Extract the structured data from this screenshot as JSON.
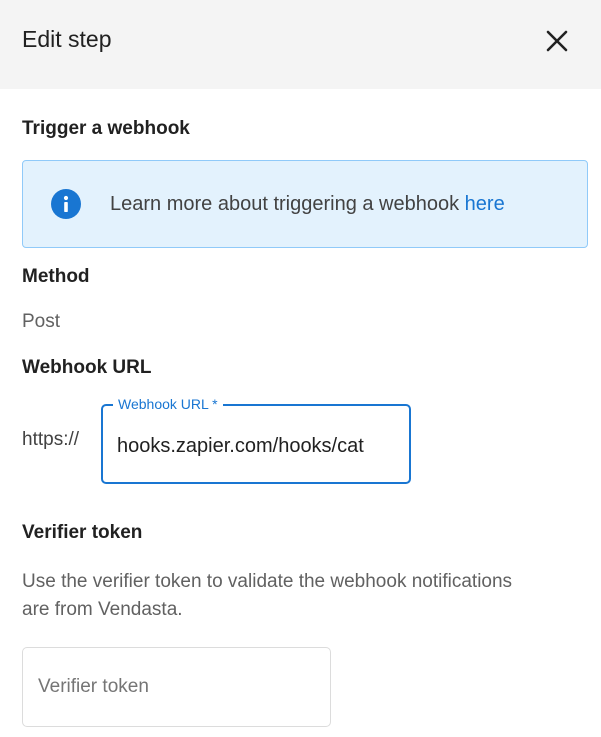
{
  "header": {
    "title": "Edit step",
    "close_icon": "close-icon"
  },
  "trigger_section": {
    "title": "Trigger a webhook",
    "info": {
      "icon": "info-icon",
      "text": "Learn more about triggering a webhook ",
      "link_label": "here"
    }
  },
  "method_section": {
    "title": "Method",
    "value": "Post"
  },
  "url_section": {
    "title": "Webhook URL",
    "prefix": "https://",
    "field_label": "Webhook URL *",
    "field_value": "hooks.zapier.com/hooks/cat"
  },
  "verifier_section": {
    "title": "Verifier token",
    "description": "Use the verifier token to validate the webhook notifications are from Vendasta.",
    "placeholder": "Verifier token",
    "value": ""
  },
  "colors": {
    "accent": "#1976d2",
    "info_bg": "#e3f2fd",
    "header_bg": "#f4f4f4"
  }
}
